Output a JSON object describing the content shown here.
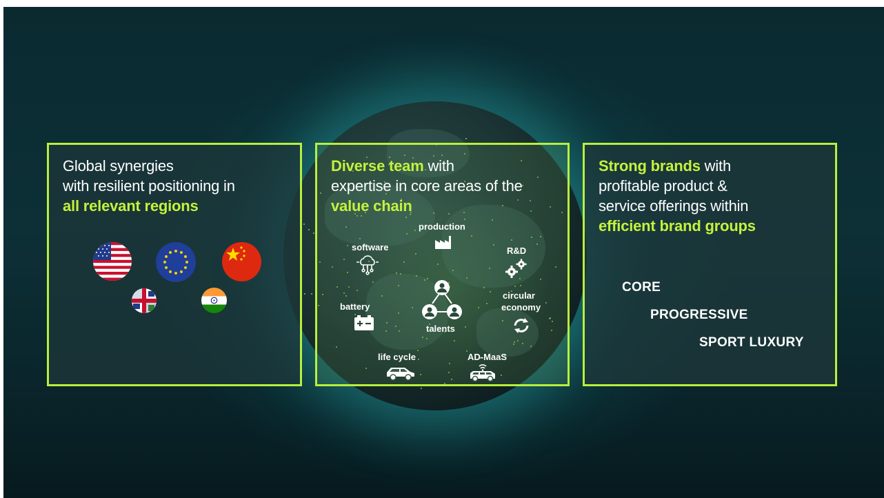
{
  "panels": {
    "left": {
      "heading": {
        "line1": "Global synergies",
        "line2": "with resilient positioning in",
        "line3_highlight": "all relevant regions"
      },
      "flags": [
        "usa-flag-icon",
        "eu-flag-icon",
        "china-flag-icon",
        "uk-flag-icon",
        "india-flag-icon"
      ]
    },
    "middle": {
      "heading": {
        "line1_highlight": "Diverse team",
        "line1_rest": " with",
        "line2": "expertise in core areas of the",
        "line3_highlight": "value chain"
      },
      "items": {
        "production": "production",
        "software": "software",
        "rnd": "R&D",
        "circular_line1": "circular",
        "circular_line2": "economy",
        "battery": "battery",
        "talents": "talents",
        "lifecycle": "life cycle",
        "admaas": "AD-MaaS"
      }
    },
    "right": {
      "heading": {
        "line1_highlight": "Strong brands",
        "line1_rest": " with",
        "line2": "profitable product &",
        "line3": "service offerings within",
        "line4_highlight": "efficient brand groups"
      },
      "brands": {
        "core": "CORE",
        "progressive": "PROGRESSIVE",
        "sport_luxury": "SPORT LUXURY"
      }
    }
  },
  "colors": {
    "accent": "#b7f03c",
    "highlight_text": "#c4f23c",
    "text": "#ffffff"
  }
}
